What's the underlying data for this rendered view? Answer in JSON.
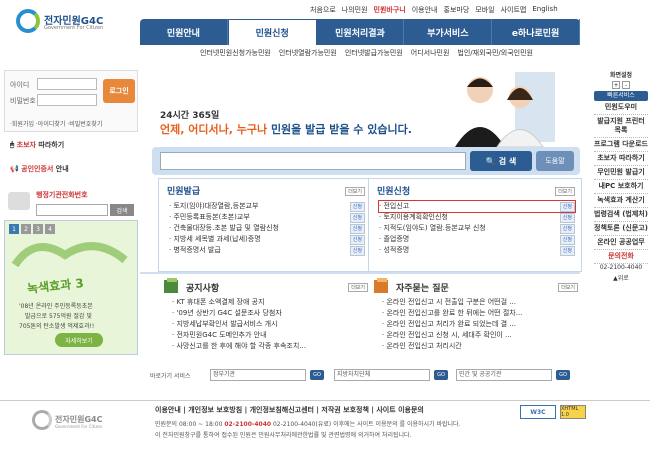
{
  "logo": {
    "title": "전자민원G4C",
    "subtitle": "Government For Citizen"
  },
  "util_links": [
    "처음으로",
    "나의민원",
    "민원바구니",
    "이용안내",
    "홍보마당",
    "모바일",
    "사이트맵",
    "English"
  ],
  "nav": {
    "tabs": [
      "민원안내",
      "민원신청",
      "민원처리결과",
      "부가서비스",
      "e하나로민원"
    ],
    "active": 1,
    "subtabs": [
      "인터넷민원신청가능민원",
      "인터넷열람가능민원",
      "인터넷발급가능민원",
      "어디서나민원",
      "법인/재외국민/외국인민원"
    ]
  },
  "login": {
    "id_label": "아이디",
    "pw_label": "비밀번호",
    "button": "로그인",
    "links": "·회원가입 ·아이디찾기 ·비밀번호찾기"
  },
  "side": {
    "beginner": "초보자",
    "beginner_suffix": "따라하기",
    "cert": "공인인증서",
    "cert_suffix": "안내",
    "office_label": "행정기관전화번호",
    "office_btn": "검색",
    "banner_title": "녹색효과 3",
    "banner_text1": "'08년 온라인 주민등록등초본",
    "banner_text2": "발급으로 575억원 절감 및",
    "banner_text3": "705톤의 탄소발생 억제효과!!",
    "banner_btn": "자세히보기",
    "banner_nums": [
      "1",
      "2",
      "3",
      "4"
    ]
  },
  "hero": {
    "line1": "24시간 365일",
    "line2a": "언제, 어디서나, 누구나",
    "line2b": " 민원을 발급 받을 수 있습니다."
  },
  "search": {
    "placeholder": "",
    "button": "검 색",
    "help": "도움말"
  },
  "panels": {
    "issue": {
      "title": "민원발급",
      "more": "더보기",
      "items": [
        "토지(임야)대장열람,등본교부",
        "주민등록표등본(초본)교부",
        "건축물대장등.초본 발급 및 열람신청",
        "지방세 세목별 과세(납세)증명",
        "병적증명서 발급"
      ],
      "chip": "신청"
    },
    "apply": {
      "title": "민원신청",
      "more": "더보기",
      "items": [
        "전입신고",
        "토지이용계획확인신청",
        "지적도(임야도) 열람.등본교부 신청",
        "졸업증명",
        "성적증명"
      ],
      "chip": "신청"
    }
  },
  "notice": {
    "title": "공지사항",
    "more": "더보기",
    "items": [
      "KT 휴대폰 소액결제 장애 공지",
      "'09년 상반기 G4C 설문조사 당첨자",
      "지방세납부확인서 발급서비스 개시",
      "전자민원G4C 도메인추가 안내",
      "사망신고를 한 후에 해야 할 각종 후속조치..."
    ]
  },
  "faq": {
    "title": "자주묻는 질문",
    "more": "더보기",
    "items": [
      "온라인 전입신고 시 전출입 구분은 어떤걸 ...",
      "온라인 전입신고를 완료 한 뒤에는 어떤 절차...",
      "온라인 전입신고 처리가 완료 되었는데 결 ...",
      "온라인 전입신고 신청 시, 세대주 확인이 ...",
      "온라인 전입신고 처리시간"
    ]
  },
  "filters": {
    "label": "바로가기 서비스",
    "selects": [
      "정부기관",
      "지방자치단체",
      "민간 및 공공기관"
    ],
    "go": "GO"
  },
  "footer": {
    "links": "이용안내 | 개인정보 보호방침 | 개인정보침해신고센터 | 저작권 보호정책 | 사이트 이용문의",
    "addr_a": "민원문의 08:00 ~ 18:00 ",
    "addr_phone": "02-2100-4040",
    "addr_b": " 02-2100-4040(유료) 이후에는 사이트 이용문의 를 이용하시기 바랍니다.",
    "note": "이 전자민원창구를 통하여 접수된 민원은 민원사무처리에관한법률 및 관련법령에 의거하여 처리됩니다.",
    "logo": "전자민원G4C",
    "logo_sub": "Government For Citizen",
    "w3c": "W3C",
    "xhtml": "XHTML 1.0"
  },
  "right": {
    "zoom_title": "화면설정",
    "zoom_plus": "+",
    "zoom_minus": "-",
    "quick": "빠른서비스",
    "items": [
      "민원도우미",
      "발급지원 프린터 목록",
      "프로그램 다운로드",
      "초보자 따라하기",
      "무인민원 발급기",
      "내PC 보호하기",
      "녹색효과 계산기",
      "법령검색 (법제처)",
      "정책토론 (신문고)",
      "온라인 공공업무"
    ],
    "contact_title": "문의전화",
    "phone": "02-2100-4040",
    "up": "▲위로"
  }
}
